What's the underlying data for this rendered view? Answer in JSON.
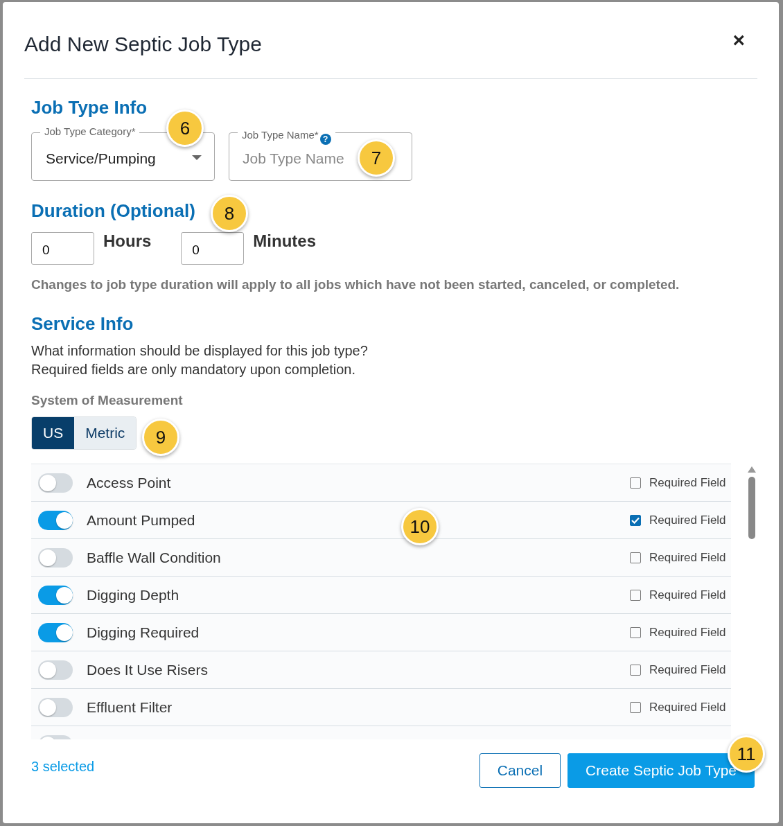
{
  "dialog": {
    "title": "Add New Septic Job Type",
    "close": "×"
  },
  "job_type_info": {
    "heading": "Job Type Info",
    "category": {
      "label": "Job Type Category*",
      "value": "Service/Pumping"
    },
    "name": {
      "label": "Job Type Name*",
      "help": "?",
      "placeholder": "Job Type Name"
    }
  },
  "duration": {
    "heading": "Duration (Optional)",
    "hours": {
      "value": "0",
      "label": "Hours"
    },
    "minutes": {
      "value": "0",
      "label": "Minutes"
    },
    "note": "Changes to job type duration will apply to all jobs which have not been started, canceled, or completed."
  },
  "service_info": {
    "heading": "Service Info",
    "description": [
      "What information should be displayed for this job type?",
      "Required fields are only mandatory upon completion."
    ],
    "measurement": {
      "label": "System of Measurement",
      "options": [
        {
          "label": "US",
          "selected": true
        },
        {
          "label": "Metric",
          "selected": false
        }
      ]
    },
    "fields": [
      {
        "name": "Access Point",
        "on": false,
        "required": false,
        "required_label": "Required Field"
      },
      {
        "name": "Amount Pumped",
        "on": true,
        "required": true,
        "required_label": "Required Field"
      },
      {
        "name": "Baffle Wall Condition",
        "on": false,
        "required": false,
        "required_label": "Required Field"
      },
      {
        "name": "Digging Depth",
        "on": true,
        "required": false,
        "required_label": "Required Field"
      },
      {
        "name": "Digging Required",
        "on": true,
        "required": false,
        "required_label": "Required Field"
      },
      {
        "name": "Does It Use Risers",
        "on": false,
        "required": false,
        "required_label": "Required Field"
      },
      {
        "name": "Effluent Filter",
        "on": false,
        "required": false,
        "required_label": "Required Field"
      },
      {
        "on": false
      }
    ]
  },
  "footer": {
    "selected_count": "3 selected",
    "buttons": [
      {
        "label": "Cancel",
        "kind": "secondary"
      },
      {
        "label": "Create Septic Job Type",
        "kind": "primary"
      }
    ]
  },
  "callouts": [
    "6",
    "7",
    "8",
    "9",
    "10",
    "11"
  ]
}
